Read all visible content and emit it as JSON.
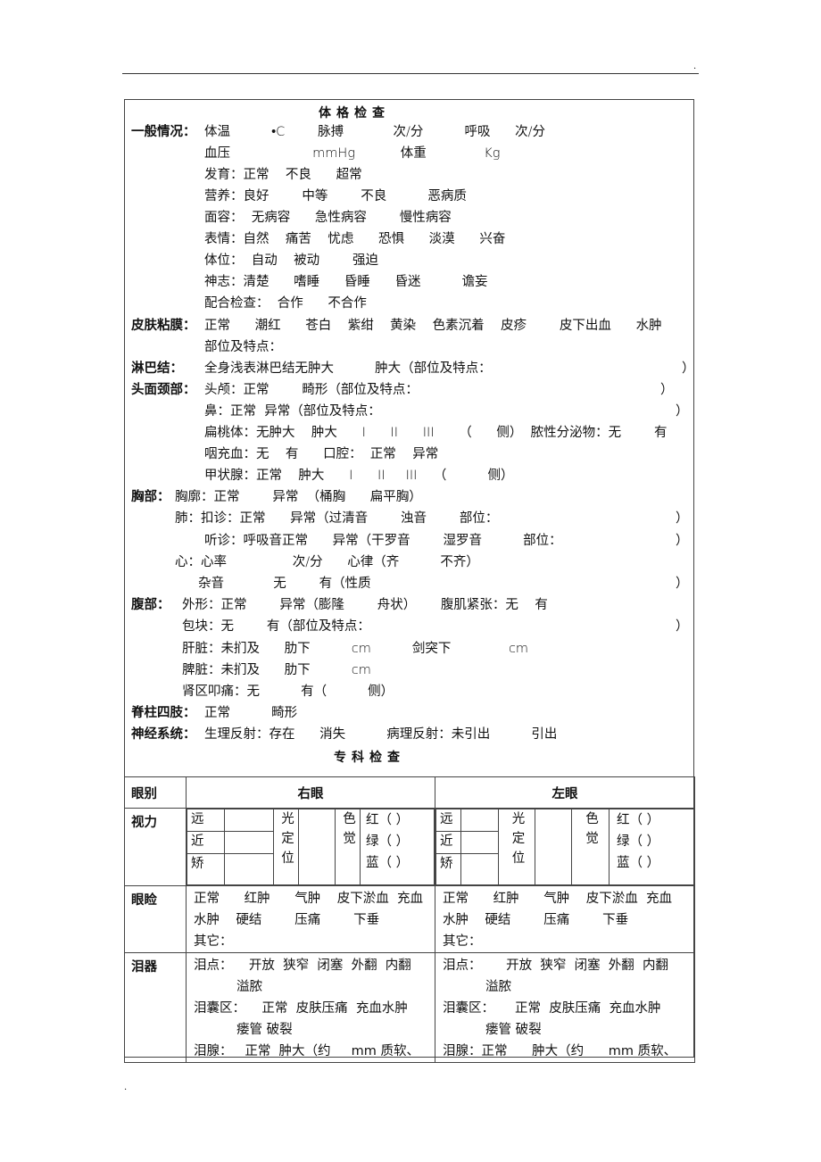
{
  "page": {
    "header_dot": ".",
    "footer_dot": "."
  },
  "physical_exam": {
    "title": "体格检查",
    "general": {
      "label": "一般情况：",
      "lines": [
        "体温          •C        脉搏            次/分          呼吸      次/分",
        "血压                    mmHg           体重              Kg",
        "发育：正常    不良      超常",
        "营养：良好        中等        不良          恶病质",
        "面容：  无病容      急性病容        慢性病容",
        "表情：自然    痛苦    忧虑      恐惧      淡漠      兴奋",
        "体位：  自动    被动        强迫",
        "神志：清楚      嗜睡      昏睡      昏迷          谵妄",
        "配合检查：  合作      不合作"
      ]
    },
    "skin": {
      "label": "皮肤粘膜：",
      "lines": [
        "正常      潮红      苍白    紫绀    黄染    色素沉着    皮疹        皮下出血      水肿",
        "部位及特点："
      ]
    },
    "lymph": {
      "label": "淋巴结：",
      "text": "全身浅表淋巴结无肿大          肿大（部位及特点：",
      "close": "）"
    },
    "head_neck": {
      "label": "头面颈部：",
      "lines": [
        {
          "text": "头颅：正常        畸形（部位及特点：",
          "close": "）"
        },
        {
          "text": "鼻：正常  异常（部位及特点：",
          "close": "）"
        },
        {
          "text": "扁桃体：无肿大    肿大      I      II      III      （      侧）  脓性分泌物：无        有",
          "close": ""
        },
        {
          "text": "咽充血：无    有      口腔：  正常    异常",
          "close": ""
        },
        {
          "text": "甲状腺：正常    肿大      I      II     III    （          侧）",
          "close": ""
        }
      ]
    },
    "chest": {
      "label": "胸部：",
      "thorax": "胸廓：正常        异常  （桶胸      扁平胸）",
      "lung_percussion": {
        "text": "肺：扣诊：正常      异常（过清音        浊音        部位：",
        "close": "）"
      },
      "lung_auscultation": {
        "text": "听诊：呼吸音正常      异常（干罗音        湿罗音          部位：",
        "close": "）"
      },
      "heart": "心：心率                次/分      心律（齐          不齐）",
      "murmur": {
        "text": "杂音            无        有（性质",
        "close": "）"
      }
    },
    "abdomen": {
      "label": "腹部：",
      "shape": "外形：正常        异常（膨隆        舟状）      腹肌紧张：无    有",
      "mass": {
        "text": "包块：无        有（部位及特点：",
        "close": "）"
      },
      "liver": "肝脏：未扪及      肋下          cm          剑突下              cm",
      "spleen": "脾脏：未扪及      肋下          cm",
      "kidney": "肾区叩痛：无          有（          侧）"
    },
    "spine": {
      "label": "脊柱四肢：",
      "text": "正常          畸形"
    },
    "nervous": {
      "label": "神经系统：",
      "text": "生理反射：存在      消失          病理反射：未引出          引出"
    }
  },
  "specialty_exam": {
    "title": "专科检查",
    "header": {
      "col0": "眼别",
      "right": "右眼",
      "left": "左眼"
    },
    "vision": {
      "label": "视力",
      "rows": [
        "远",
        "近",
        "矫"
      ],
      "light_loc": [
        "光",
        "定",
        "位"
      ],
      "color": [
        "色",
        "觉"
      ],
      "colors": [
        "红（    ）",
        "绿（    ）",
        "蓝（    ）"
      ]
    },
    "eyelid": {
      "label": "眼睑",
      "lines": [
        "正常      红肿      气肿    皮下淤血  充血",
        "水肿    硬结        压痛        下垂",
        "其它："
      ]
    },
    "lacrimal": {
      "label": "泪器",
      "right": {
        "punctum": "泪点：    开放  狭窄  闭塞  外翻  内翻",
        "punctum_cont": "溢脓",
        "sac": "泪囊区：    正常  皮肤压痛  充血水肿",
        "sac_cont": "瘘管  破裂",
        "gland": "泪腺：   正常  肿大（约     mm 质软、"
      },
      "left": {
        "punctum": "泪点：      开放  狭窄  闭塞  外翻  内翻",
        "punctum_cont": "溢脓",
        "sac": "泪囊区：     正常  皮肤压痛  充血水肿",
        "sac_cont": "瘘管  破裂",
        "gland": "泪腺：正常      肿大（约      mm 质软、"
      }
    }
  }
}
